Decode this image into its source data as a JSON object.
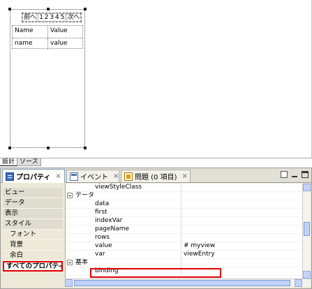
{
  "canvas": {
    "pager": {
      "first_label": "前へ",
      "pages": "1 2 3 4 5",
      "next_label": "次へ"
    },
    "table": {
      "headers": [
        "Name",
        "Value"
      ],
      "row": [
        "name",
        "value"
      ]
    }
  },
  "mode_tabs": [
    "設計",
    "ソース"
  ],
  "view_tabs": {
    "properties": "プロパティ",
    "events": "イベント",
    "problems": "問題 (0 項目)",
    "close": "×"
  },
  "categories": [
    {
      "label": "ビュー",
      "sub": false,
      "selected": false
    },
    {
      "label": "データ",
      "sub": false,
      "selected": false
    },
    {
      "label": "表示",
      "sub": false,
      "selected": false
    },
    {
      "label": "スタイル",
      "sub": false,
      "selected": false
    },
    {
      "label": "フォント",
      "sub": true,
      "selected": false
    },
    {
      "label": "背景",
      "sub": true,
      "selected": false
    },
    {
      "label": "余白",
      "sub": true,
      "selected": false
    },
    {
      "label": "すべてのプロパティ",
      "sub": false,
      "selected": true
    }
  ],
  "properties": [
    {
      "name": "viewStyleClass",
      "value": "",
      "group": false
    },
    {
      "name": "データ",
      "value": "",
      "group": true
    },
    {
      "name": "data",
      "value": "",
      "group": false
    },
    {
      "name": "first",
      "value": "",
      "group": false
    },
    {
      "name": "indexVar",
      "value": "",
      "group": false
    },
    {
      "name": "pageName",
      "value": "",
      "group": false
    },
    {
      "name": "rows",
      "value": "",
      "group": false
    },
    {
      "name": "value",
      "value": "# myview",
      "group": false
    },
    {
      "name": "var",
      "value": "viewEntry",
      "group": false
    },
    {
      "name": "基本",
      "value": "",
      "group": true
    },
    {
      "name": "binding",
      "value": "",
      "group": false
    }
  ],
  "colors": {
    "highlight": "#e00000",
    "panel_bg": "#ece9d8",
    "scroll_thumb": "#c1d2fb"
  }
}
